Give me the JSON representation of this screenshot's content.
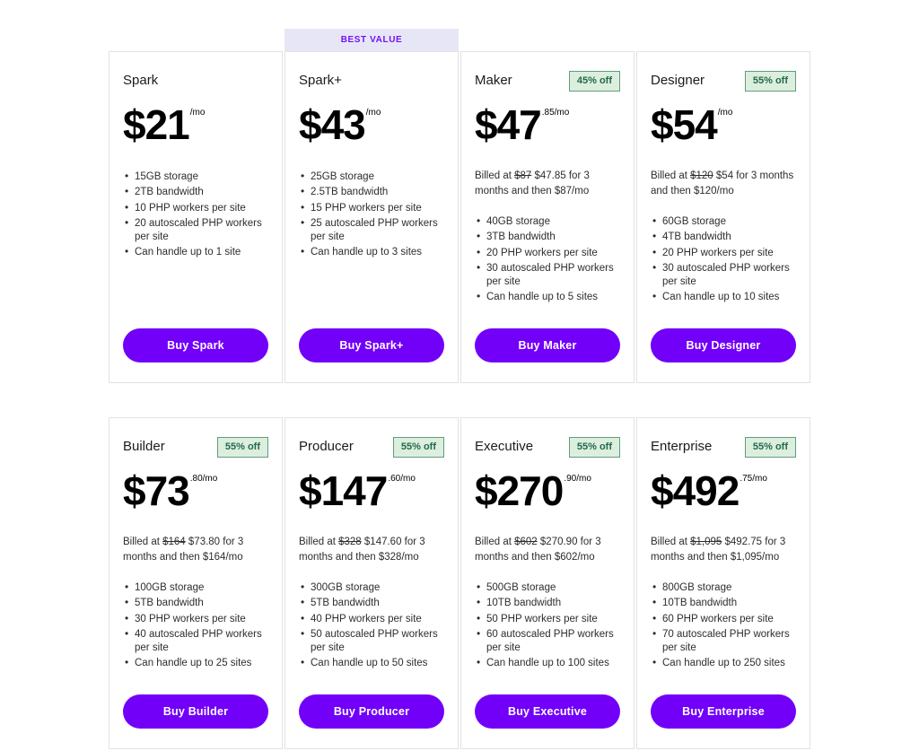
{
  "theme": {
    "accent_purple": "#7200f8",
    "ribbon_bg": "#e7e6f7",
    "ribbon_text": "#7214ef",
    "badge_bg": "#ddeede",
    "badge_border": "#5d9e7e",
    "badge_text": "#1f6b4a",
    "card_border": "#e2e2e4",
    "page_bg": "#ffffff"
  },
  "ribbon": {
    "best_value_label": "BEST VALUE"
  },
  "rows": [
    {
      "cards": [
        {
          "name": "Spark",
          "badge": "",
          "ribbon": "",
          "price_main": "$21",
          "price_sup": "/mo",
          "billed": "",
          "billed_old": "",
          "billed_rest": "",
          "features": [
            "15GB storage",
            "2TB bandwidth",
            "10 PHP workers per site",
            "20 autoscaled PHP workers per site",
            "Can handle up to 1 site"
          ],
          "buy_label": "Buy Spark"
        },
        {
          "name": "Spark+",
          "badge": "",
          "ribbon": "BEST VALUE",
          "price_main": "$43",
          "price_sup": "/mo",
          "billed": "",
          "billed_old": "",
          "billed_rest": "",
          "features": [
            "25GB storage",
            "2.5TB bandwidth",
            "15 PHP workers per site",
            "25 autoscaled PHP workers per site",
            "Can handle up to 3 sites"
          ],
          "buy_label": "Buy Spark+"
        },
        {
          "name": "Maker",
          "badge": "45% off",
          "ribbon": "",
          "price_main": "$47",
          "price_sup": ".85/mo",
          "billed_prefix": "Billed at ",
          "billed_old": "$87",
          "billed_rest": " $47.85 for 3 months and then $87/mo",
          "features": [
            "40GB storage",
            "3TB bandwidth",
            "20 PHP workers per site",
            "30 autoscaled PHP workers per site",
            "Can handle up to 5 sites"
          ],
          "buy_label": "Buy Maker"
        },
        {
          "name": "Designer",
          "badge": "55% off",
          "ribbon": "",
          "price_main": "$54",
          "price_sup": "/mo",
          "billed_prefix": "Billed at ",
          "billed_old": "$120",
          "billed_rest": " $54 for 3 months and then $120/mo",
          "features": [
            "60GB storage",
            "4TB bandwidth",
            "20 PHP workers per site",
            "30 autoscaled PHP workers per site",
            "Can handle up to 10 sites"
          ],
          "buy_label": "Buy Designer"
        }
      ]
    },
    {
      "cards": [
        {
          "name": "Builder",
          "badge": "55% off",
          "ribbon": "",
          "price_main": "$73",
          "price_sup": ".80/mo",
          "billed_prefix": "Billed at ",
          "billed_old": "$164",
          "billed_rest": " $73.80 for 3 months and then $164/mo",
          "features": [
            "100GB storage",
            "5TB bandwidth",
            "30 PHP workers per site",
            "40 autoscaled PHP workers per site",
            "Can handle up to 25 sites"
          ],
          "buy_label": "Buy Builder"
        },
        {
          "name": "Producer",
          "badge": "55% off",
          "ribbon": "",
          "price_main": "$147",
          "price_sup": ".60/mo",
          "billed_prefix": "Billed at ",
          "billed_old": "$328",
          "billed_rest": " $147.60 for 3 months and then $328/mo",
          "features": [
            "300GB storage",
            "5TB bandwidth",
            "40 PHP workers per site",
            "50 autoscaled PHP workers per site",
            "Can handle up to 50 sites"
          ],
          "buy_label": "Buy Producer"
        },
        {
          "name": "Executive",
          "badge": "55% off",
          "ribbon": "",
          "price_main": "$270",
          "price_sup": ".90/mo",
          "billed_prefix": "Billed at ",
          "billed_old": "$602",
          "billed_rest": " $270.90 for 3 months and then $602/mo",
          "features": [
            "500GB storage",
            "10TB bandwidth",
            "50 PHP workers per site",
            "60 autoscaled PHP workers per site",
            "Can handle up to 100 sites"
          ],
          "buy_label": "Buy Executive"
        },
        {
          "name": "Enterprise",
          "badge": "55% off",
          "ribbon": "",
          "price_main": "$492",
          "price_sup": ".75/mo",
          "billed_prefix": "Billed at ",
          "billed_old": "$1,095",
          "billed_rest": " $492.75 for 3 months and then $1,095/mo",
          "features": [
            "800GB storage",
            "10TB bandwidth",
            "60 PHP workers per site",
            "70 autoscaled PHP workers per site",
            "Can handle up to 250 sites"
          ],
          "buy_label": "Buy Enterprise"
        }
      ]
    }
  ]
}
